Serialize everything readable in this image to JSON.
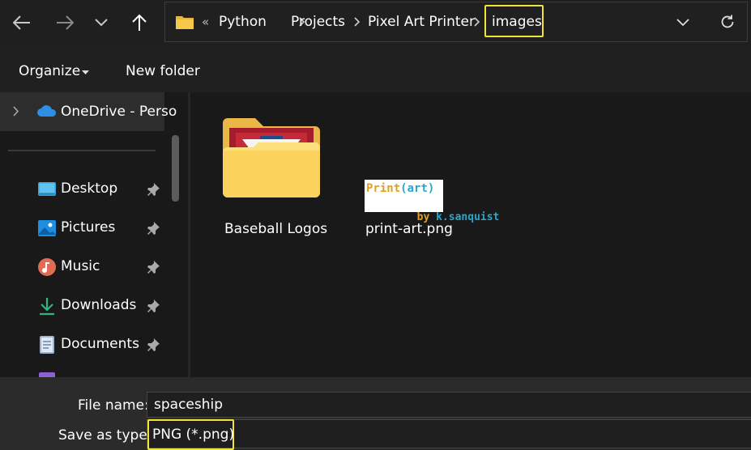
{
  "breadcrumb": {
    "overflow": "«",
    "items": [
      "Python",
      "Projects",
      "Pixel Art Printer",
      "images"
    ]
  },
  "toolbar": {
    "organize_label": "Organize",
    "new_folder_label": "New folder"
  },
  "navpane": {
    "onedrive_label": "OneDrive - Perso",
    "items": [
      {
        "label": "Desktop",
        "icon": "desktop-icon"
      },
      {
        "label": "Pictures",
        "icon": "pictures-icon"
      },
      {
        "label": "Music",
        "icon": "music-icon"
      },
      {
        "label": "Downloads",
        "icon": "downloads-icon"
      },
      {
        "label": "Documents",
        "icon": "documents-icon"
      }
    ]
  },
  "files": [
    {
      "name": "Baseball Logos",
      "type": "folder"
    },
    {
      "name": "print-art.png",
      "type": "png",
      "thumb_line1_a": "Print",
      "thumb_line1_b": "(art)",
      "thumb_line2_a": "by ",
      "thumb_line2_b": "k.sanquist"
    }
  ],
  "save": {
    "file_name_label": "File name:",
    "file_name_value": "spaceship",
    "save_as_type_label": "Save as type:",
    "save_as_type_value": "PNG (*.png)"
  },
  "colors": {
    "highlight": "#f2e23c",
    "background": "#191919",
    "folder": "#f7c948"
  }
}
